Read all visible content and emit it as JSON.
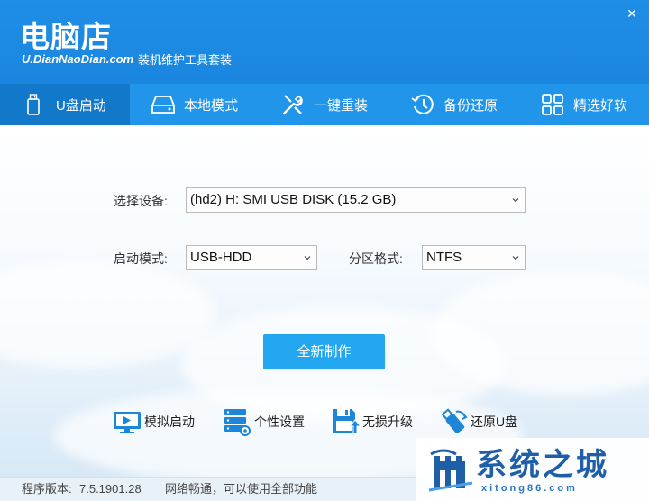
{
  "app": {
    "logo_text": "电脑店",
    "logo_domain": "U.DianNaoDian.com",
    "tagline": "装机维护工具套装",
    "minimize_label": "—",
    "close_label": "✕"
  },
  "tabs": [
    {
      "label": "U盘启动",
      "icon": "usb-drive-icon",
      "active": true
    },
    {
      "label": "本地模式",
      "icon": "hard-disk-icon",
      "active": false
    },
    {
      "label": "一键重装",
      "icon": "tools-icon",
      "active": false
    },
    {
      "label": "备份还原",
      "icon": "history-icon",
      "active": false
    },
    {
      "label": "精选好软",
      "icon": "app-grid-icon",
      "active": false
    }
  ],
  "form": {
    "device_label": "选择设备:",
    "device_value": "(hd2) H: SMI USB DISK (15.2 GB)",
    "boot_mode_label": "启动模式:",
    "boot_mode_value": "USB-HDD",
    "partition_label": "分区格式:",
    "partition_value": "NTFS"
  },
  "make_button": "全新制作",
  "tools": [
    {
      "label": "模拟启动",
      "icon": "monitor-icon"
    },
    {
      "label": "个性设置",
      "icon": "server-settings-icon"
    },
    {
      "label": "无损升级",
      "icon": "upgrade-disk-icon"
    },
    {
      "label": "还原U盘",
      "icon": "usb-restore-icon"
    }
  ],
  "status": {
    "version_label": "程序版本:",
    "version_value": "7.5.1901.28",
    "network_text": "网络畅通，可以使用全部功能"
  },
  "watermark": {
    "title": "系统之城",
    "url": "xitong86.com"
  },
  "colors": {
    "header_blue": "#1f8ee6",
    "active_tab": "#1278c9",
    "button_blue": "#23a6f0"
  }
}
